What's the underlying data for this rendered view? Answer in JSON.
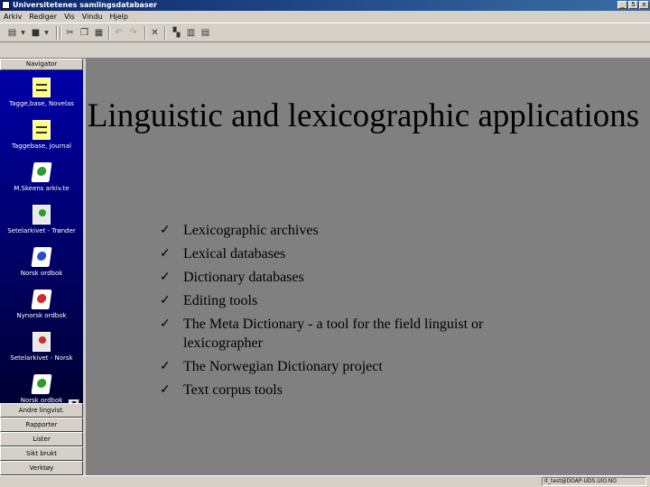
{
  "window": {
    "title": "Universitetenes samlingsdatabaser",
    "minimize": "_",
    "restore": "5",
    "close": "x"
  },
  "menu": [
    "Arkiv",
    "Rediger",
    "Vis",
    "Vindu",
    "Hjelp"
  ],
  "sidebar": {
    "header": "Navigator",
    "items": [
      {
        "label": "Tagge,base, Novelas",
        "icon": "database-icon"
      },
      {
        "label": "Taggebase, Journal",
        "icon": "database-icon"
      },
      {
        "label": "M.Skeens arkiv.te",
        "icon": "book-icon"
      },
      {
        "label": "Setelarkivet - Trønder",
        "icon": "form-icon"
      },
      {
        "label": "Norsk ordbok",
        "icon": "book-icon"
      },
      {
        "label": "Nynorsk ordbok",
        "icon": "book-icon"
      },
      {
        "label": "Setelarkivet - Norsk",
        "icon": "form-icon"
      },
      {
        "label": "Norsk ordbok",
        "icon": "book-icon"
      }
    ],
    "buttons": [
      "Andre lingvist.",
      "Rapporter",
      "Lister",
      "Sikt brukt",
      "Verktøy"
    ]
  },
  "slide": {
    "title": "Linguistic and lexicographic applications",
    "bullets": [
      "Lexicographic  archives",
      "Lexical databases",
      "Dictionary databases",
      "Editing tools",
      "The Meta Dictionary - a tool for  the field linguist or lexicographer",
      "The Norwegian Dictionary project",
      "Text corpus tools"
    ],
    "check": "ü"
  },
  "status": {
    "text": "it_test@DOAP-UDS.UIO.NO"
  }
}
